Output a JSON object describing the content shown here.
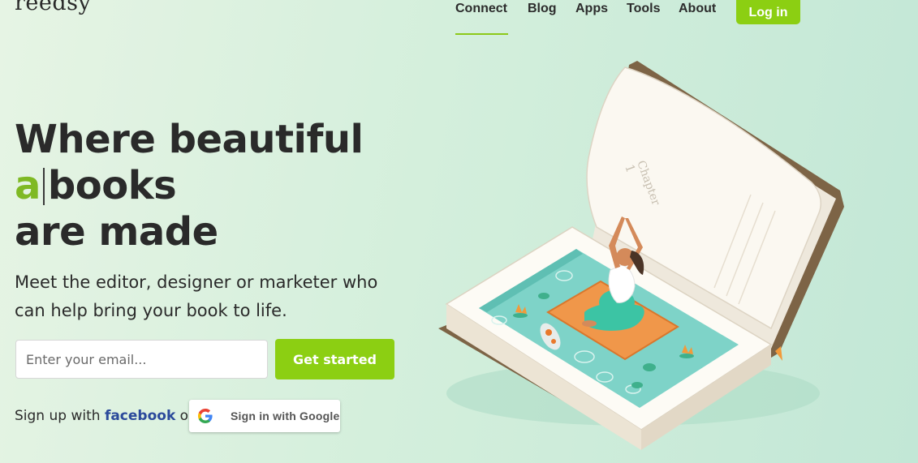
{
  "brand": {
    "logo_text": "reedsy"
  },
  "nav": {
    "items": [
      {
        "label": "Connect",
        "active": true
      },
      {
        "label": "Blog"
      },
      {
        "label": "Apps"
      },
      {
        "label": "Tools"
      },
      {
        "label": "About"
      }
    ],
    "login_label": "Log in"
  },
  "hero": {
    "line1": "Where beautiful",
    "typed_text": "a",
    "line2_rest": "books",
    "line3": "are made",
    "subtitle": "Meet the editor, designer or marketer who can help bring your book to life.",
    "email_placeholder": "Enter your email...",
    "cta_label": "Get started",
    "signup_prefix": "Sign up with",
    "facebook_label": "facebook",
    "or_label": "or",
    "google_label": "Sign in with Google"
  },
  "illustration": {
    "page_number": "1",
    "page_heading": "Chapter"
  },
  "colors": {
    "accent": "#8ccf12",
    "facebook": "#2b4a9b",
    "text": "#2a2a2a"
  }
}
